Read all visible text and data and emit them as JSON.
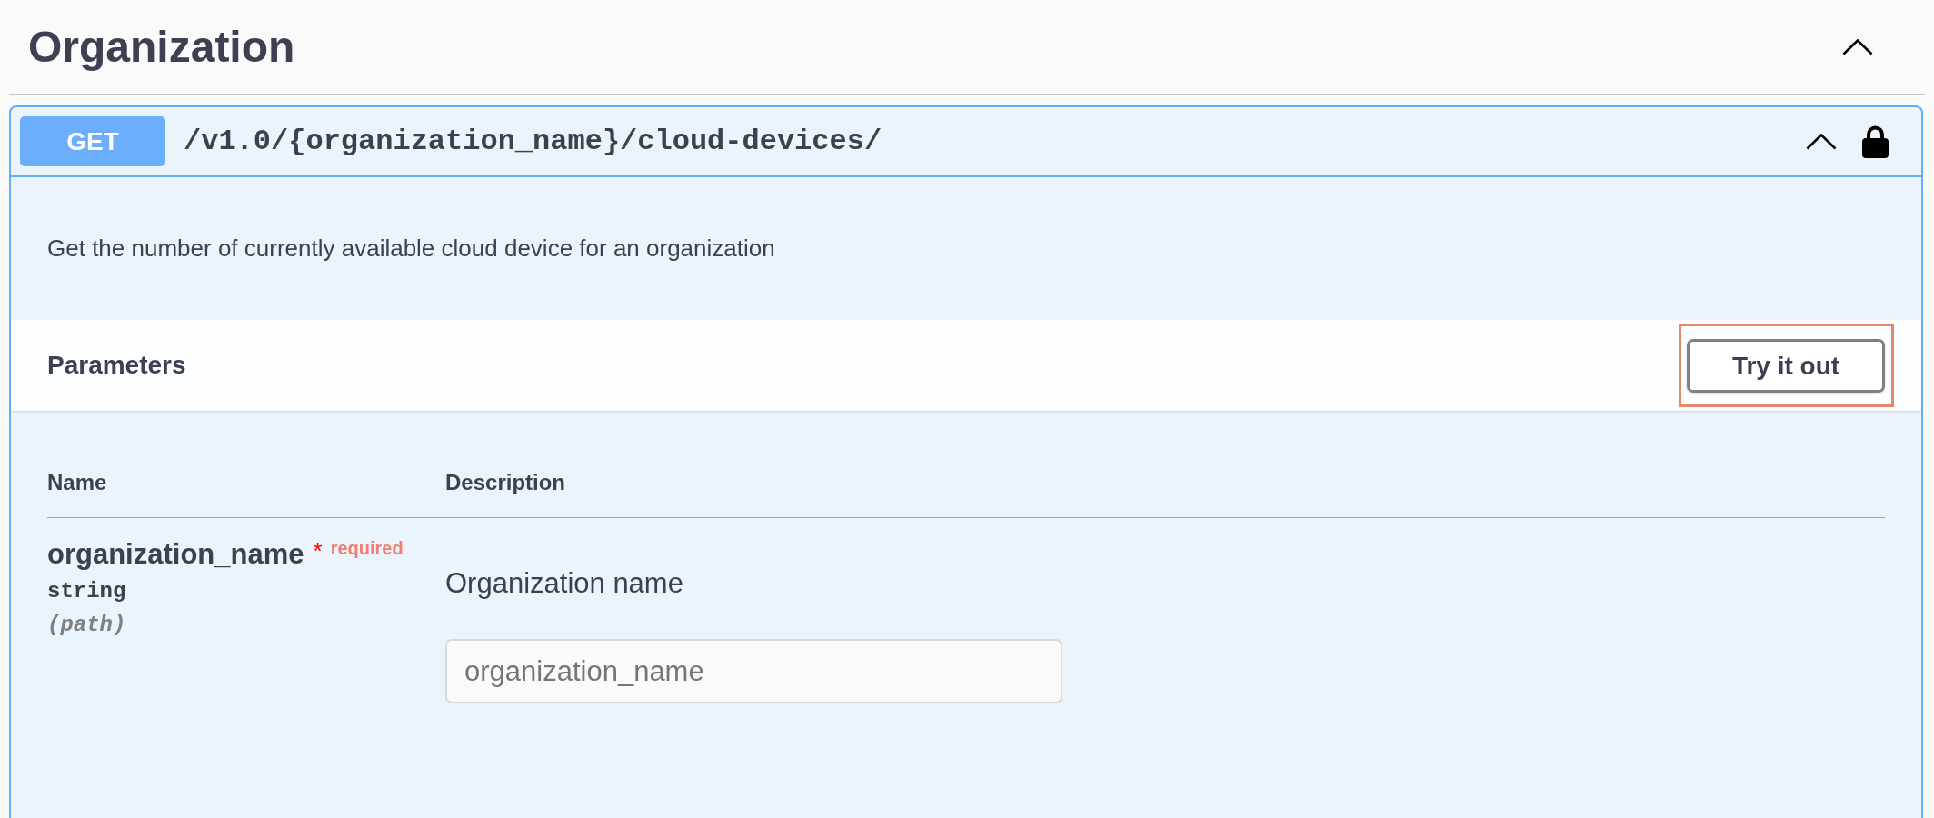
{
  "section": {
    "title": "Organization",
    "expanded": true,
    "operation": {
      "method": "GET",
      "path": "/v1.0/{organization_name}/cloud-devices/",
      "expanded": true,
      "locked": true,
      "description": "Get the number of currently available cloud device for an organization",
      "parameters_heading": "Parameters",
      "try_button": {
        "label": "Try it out",
        "highlighted": true
      },
      "table": {
        "columns": [
          "Name",
          "Description"
        ],
        "rows": [
          {
            "name": "organization_name",
            "required_mark": "*",
            "required_label": "required",
            "type": "string",
            "location": "(path)",
            "description": "Organization name",
            "placeholder": "organization_name"
          }
        ]
      }
    }
  }
}
